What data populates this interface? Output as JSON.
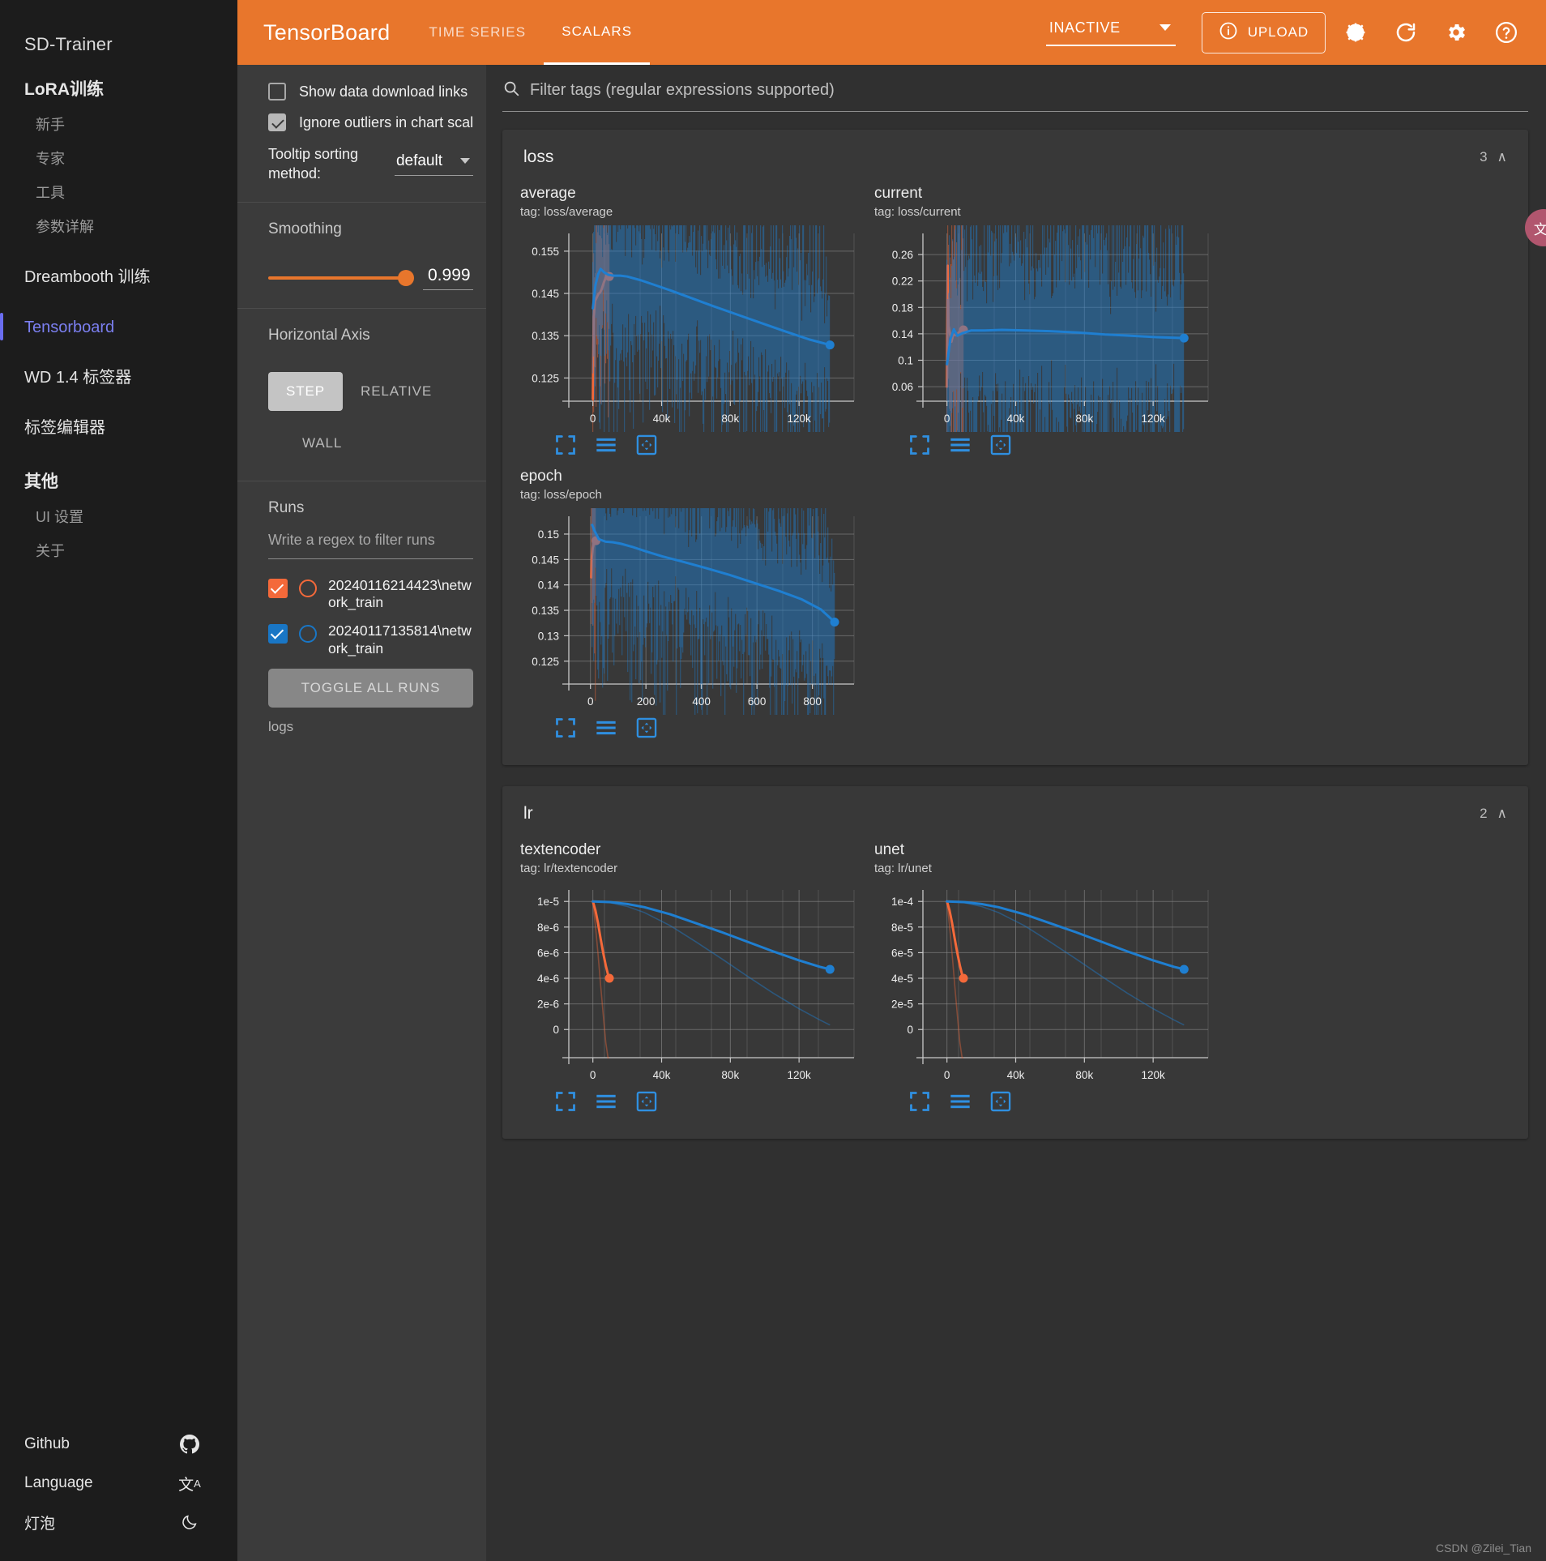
{
  "sidebar": {
    "title": "SD-Trainer",
    "group_lora": "LoRA训练",
    "lora_subitems": [
      "新手",
      "专家",
      "工具",
      "参数详解"
    ],
    "item_dreambooth": "Dreambooth 训练",
    "item_tensorboard": "Tensorboard",
    "item_wd": "WD 1.4 标签器",
    "item_tageditor": "标签编辑器",
    "group_other": "其他",
    "other_subitems": [
      "UI 设置",
      "关于"
    ],
    "bottom": [
      {
        "label": "Github",
        "icon": "github-icon"
      },
      {
        "label": "Language",
        "icon": "translate-icon"
      },
      {
        "label": "灯泡",
        "icon": "moon-icon"
      }
    ]
  },
  "header": {
    "logo": "TensorBoard",
    "tabs": [
      {
        "label": "TIME SERIES",
        "active": false
      },
      {
        "label": "SCALARS",
        "active": true
      }
    ],
    "run_status": "INACTIVE",
    "upload_label": "UPLOAD",
    "icons": [
      "brightness-icon",
      "refresh-icon",
      "gear-icon",
      "help-icon"
    ],
    "accent_color": "#e8762c"
  },
  "controls": {
    "show_downloads_label": "Show data download links",
    "show_downloads_checked": false,
    "ignore_outliers_label": "Ignore outliers in chart scali",
    "ignore_outliers_checked": true,
    "tooltip_label": "Tooltip sorting method:",
    "tooltip_value": "default",
    "smoothing_label": "Smoothing",
    "smoothing_value": "0.999",
    "horizontal_axis_label": "Horizontal Axis",
    "axis_options": [
      "STEP",
      "RELATIVE",
      "WALL"
    ],
    "axis_selected": "STEP",
    "runs_label": "Runs",
    "runs_filter_placeholder": "Write a regex to filter runs",
    "runs": [
      {
        "name": "20240116214423\\network_train",
        "color": "#f4693a",
        "checked": true
      },
      {
        "name": "20240117135814\\network_train",
        "color": "#1976c5",
        "checked": true
      }
    ],
    "toggle_all_label": "TOGGLE ALL RUNS",
    "logs_label": "logs"
  },
  "filter": {
    "placeholder": "Filter tags (regular expressions supported)",
    "icon": "search-icon"
  },
  "cards": [
    {
      "title": "loss",
      "count": "3",
      "chevron": "∧"
    },
    {
      "title": "lr",
      "count": "2",
      "chevron": "∧"
    }
  ],
  "chart_data": [
    {
      "type": "line",
      "title": "average",
      "subtitle": "tag: loss/average",
      "xlabel": "",
      "ylabel": "",
      "xticks": [
        "0",
        "40k",
        "80k",
        "120k"
      ],
      "xtick_values": [
        0,
        40000,
        80000,
        120000
      ],
      "yticks": [
        "0.125",
        "0.135",
        "0.145",
        "0.155"
      ],
      "ytick_values": [
        0.125,
        0.135,
        0.145,
        0.155
      ],
      "xlim": [
        -14000,
        152000
      ],
      "ylim": [
        0.1195,
        0.1592
      ],
      "grid": true,
      "legend": "none",
      "series": [
        {
          "name": "20240116214423\\network_train",
          "color": "#f4693a",
          "x": [
            0,
            500,
            1200,
            2200,
            3200,
            4200,
            5200,
            6200,
            7400,
            8600,
            9600
          ],
          "y": [
            0.12,
            0.1395,
            0.1432,
            0.144,
            0.1449,
            0.1452,
            0.1461,
            0.1474,
            0.1487,
            0.1489,
            0.149
          ],
          "end_marker": {
            "x": 9600,
            "y": 0.149
          }
        },
        {
          "name": "20240117135814\\network_train",
          "color": "#1f7fd1",
          "x": [
            0,
            1500,
            3000,
            4500,
            6500,
            9000,
            12000,
            16000,
            20000,
            28000,
            36000,
            46000,
            58000,
            70000,
            84000,
            98000,
            112000,
            126000,
            138000
          ],
          "y": [
            0.1415,
            0.147,
            0.1495,
            0.1508,
            0.15,
            0.1494,
            0.1492,
            0.1492,
            0.149,
            0.1481,
            0.147,
            0.1456,
            0.1438,
            0.142,
            0.14,
            0.138,
            0.136,
            0.1341,
            0.1328
          ],
          "end_marker": {
            "x": 138000,
            "y": 0.1328
          }
        }
      ]
    },
    {
      "type": "line",
      "title": "current",
      "subtitle": "tag: loss/current",
      "xticks": [
        "0",
        "40k",
        "80k",
        "120k"
      ],
      "xtick_values": [
        0,
        40000,
        80000,
        120000
      ],
      "yticks": [
        "0.06",
        "0.1",
        "0.14",
        "0.18",
        "0.22",
        "0.26"
      ],
      "ytick_values": [
        0.06,
        0.1,
        0.14,
        0.18,
        0.22,
        0.26
      ],
      "xlim": [
        -14000,
        152000
      ],
      "ylim": [
        0.038,
        0.292
      ],
      "grid": true,
      "legend": "none",
      "series": [
        {
          "name": "20240116214423\\network_train",
          "color": "#f4693a",
          "x": [
            0,
            400,
            900,
            1600,
            2600,
            3600,
            5000,
            6500,
            8000,
            9600
          ],
          "y": [
            0.06,
            0.243,
            0.152,
            0.142,
            0.128,
            0.139,
            0.138,
            0.141,
            0.145,
            0.146
          ],
          "end_marker": {
            "x": 9600,
            "y": 0.146
          }
        },
        {
          "name": "20240117135814\\network_train",
          "color": "#1f7fd1",
          "x": [
            0,
            2000,
            4000,
            6000,
            9000,
            14000,
            22000,
            32000,
            46000,
            60000,
            76000,
            92000,
            108000,
            122000,
            138000
          ],
          "y": [
            0.094,
            0.132,
            0.147,
            0.137,
            0.141,
            0.145,
            0.145,
            0.146,
            0.145,
            0.144,
            0.142,
            0.139,
            0.137,
            0.135,
            0.1335
          ],
          "end_marker": {
            "x": 138000,
            "y": 0.1335
          }
        }
      ]
    },
    {
      "type": "line",
      "title": "epoch",
      "subtitle": "tag: loss/epoch",
      "xticks": [
        "0",
        "200",
        "400",
        "600",
        "800"
      ],
      "xtick_values": [
        0,
        200,
        400,
        600,
        800
      ],
      "yticks": [
        "0.125",
        "0.13",
        "0.135",
        "0.14",
        "0.145",
        "0.15"
      ],
      "ytick_values": [
        0.125,
        0.13,
        0.135,
        0.14,
        0.145,
        0.15
      ],
      "xlim": [
        -78,
        950
      ],
      "ylim": [
        0.1205,
        0.1535
      ],
      "grid": true,
      "legend": "none",
      "series": [
        {
          "name": "20240116214423\\network_train",
          "color": "#f4693a",
          "x": [
            3,
            5,
            8,
            12,
            16,
            20
          ],
          "y": [
            0.1415,
            0.1455,
            0.1472,
            0.1482,
            0.1486,
            0.1487
          ],
          "end_marker": {
            "x": 20,
            "y": 0.1487
          }
        },
        {
          "name": "20240117135814\\network_train",
          "color": "#1f7fd1",
          "x": [
            6,
            15,
            30,
            55,
            80,
            110,
            150,
            200,
            260,
            330,
            410,
            500,
            590,
            680,
            760,
            830,
            880
          ],
          "y": [
            0.1518,
            0.1506,
            0.149,
            0.1485,
            0.1484,
            0.1481,
            0.1475,
            0.1466,
            0.1456,
            0.1446,
            0.1434,
            0.142,
            0.1404,
            0.1388,
            0.1372,
            0.1352,
            0.1327
          ],
          "end_marker": {
            "x": 880,
            "y": 0.1327
          }
        }
      ]
    },
    {
      "type": "line",
      "title": "textencoder",
      "subtitle": "tag: lr/textencoder",
      "xticks": [
        "0",
        "40k",
        "80k",
        "120k"
      ],
      "xtick_values": [
        0,
        40000,
        80000,
        120000
      ],
      "yticks": [
        "0",
        "2e-6",
        "4e-6",
        "6e-6",
        "8e-6",
        "1e-5"
      ],
      "ytick_values": [
        0,
        2e-06,
        4e-06,
        6e-06,
        8e-06,
        1e-05
      ],
      "xlim": [
        -14000,
        152000
      ],
      "ylim": [
        -2.2e-06,
        1.09e-05
      ],
      "grid": true,
      "legend": "none",
      "series": [
        {
          "name": "20240116214423\\network_train",
          "color": "#f4693a",
          "x": [
            0,
            1500,
            3000,
            4500,
            6000,
            7500,
            8800,
            9600
          ],
          "y": [
            1e-05,
            9.3e-06,
            8.3e-06,
            7.1e-06,
            6e-06,
            5e-06,
            4.3e-06,
            4e-06
          ],
          "end_marker": {
            "x": 9600,
            "y": 4e-06
          }
        },
        {
          "name": "20240117135814\\network_train",
          "color": "#1f7fd1",
          "x": [
            0,
            10000,
            20000,
            30000,
            45000,
            60000,
            75000,
            90000,
            105000,
            120000,
            132000,
            138000
          ],
          "y": [
            1e-05,
            9.95e-06,
            9.8e-06,
            9.55e-06,
            9e-06,
            8.3e-06,
            7.6e-06,
            6.85e-06,
            6.1e-06,
            5.4e-06,
            4.9e-06,
            4.7e-06
          ],
          "end_marker": {
            "x": 138000,
            "y": 4.7e-06
          }
        }
      ]
    },
    {
      "type": "line",
      "title": "unet",
      "subtitle": "tag: lr/unet",
      "xticks": [
        "0",
        "40k",
        "80k",
        "120k"
      ],
      "xtick_values": [
        0,
        40000,
        80000,
        120000
      ],
      "yticks": [
        "0",
        "2e-5",
        "4e-5",
        "6e-5",
        "8e-5",
        "1e-4"
      ],
      "ytick_values": [
        0,
        2e-05,
        4e-05,
        6e-05,
        8e-05,
        0.0001
      ],
      "xlim": [
        -14000,
        152000
      ],
      "ylim": [
        -2.2e-05,
        0.000109
      ],
      "grid": true,
      "legend": "none",
      "series": [
        {
          "name": "20240116214423\\network_train",
          "color": "#f4693a",
          "x": [
            0,
            1500,
            3000,
            4500,
            6000,
            7500,
            8800,
            9600
          ],
          "y": [
            0.0001,
            9.3e-05,
            8.3e-05,
            7.1e-05,
            6e-05,
            5e-05,
            4.3e-05,
            4e-05
          ],
          "end_marker": {
            "x": 9600,
            "y": 4e-05
          }
        },
        {
          "name": "20240117135814\\network_train",
          "color": "#1f7fd1",
          "x": [
            0,
            10000,
            20000,
            30000,
            45000,
            60000,
            75000,
            90000,
            105000,
            120000,
            132000,
            138000
          ],
          "y": [
            0.0001,
            9.95e-05,
            9.8e-05,
            9.55e-05,
            9e-05,
            8.3e-05,
            7.6e-05,
            6.85e-05,
            6.1e-05,
            5.4e-05,
            4.9e-05,
            4.7e-05
          ],
          "end_marker": {
            "x": 138000,
            "y": 4.7e-05
          }
        }
      ]
    }
  ],
  "watermark": "CSDN @Zilei_Tian"
}
